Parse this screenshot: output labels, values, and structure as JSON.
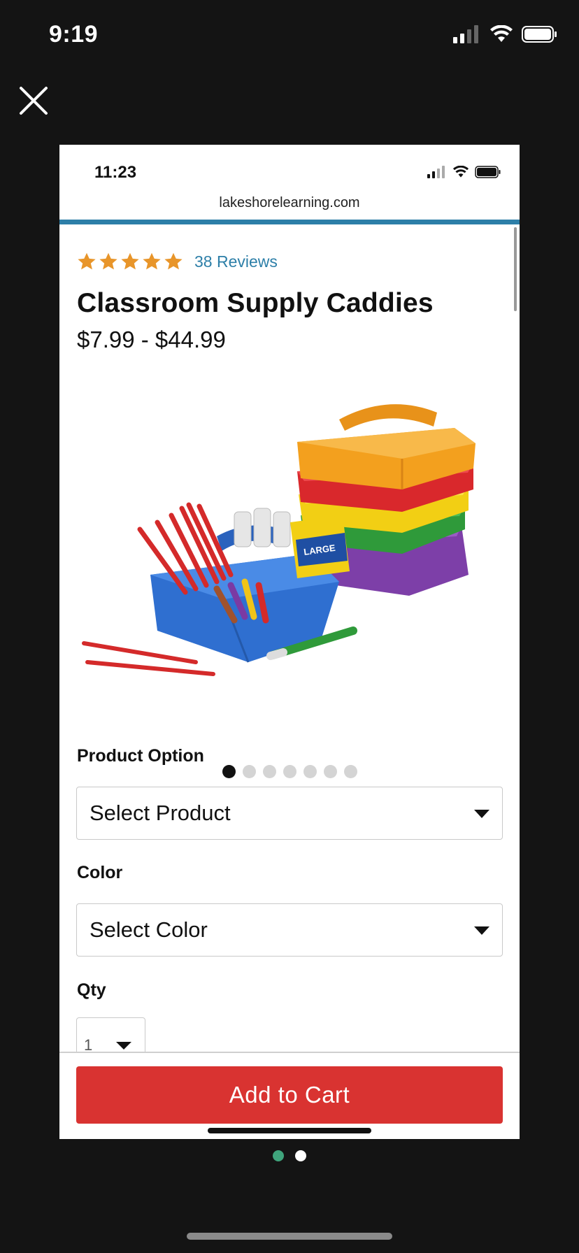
{
  "device": {
    "time": "9:19"
  },
  "screenshot": {
    "status_time": "11:23",
    "url": "lakeshorelearning.com",
    "product": {
      "rating_stars": 5,
      "reviews_label": "38 Reviews",
      "title": "Classroom Supply Caddies",
      "price_range": "$7.99 - $44.99",
      "image_count": 7,
      "active_image": 0
    },
    "form": {
      "product_option_label": "Product Option",
      "product_option_value": "Select Product",
      "color_label": "Color",
      "color_value": "Select Color",
      "qty_label": "Qty",
      "qty_value": "1"
    },
    "add_to_cart_label": "Add to Cart"
  },
  "pager": {
    "count": 2,
    "active": 0
  },
  "colors": {
    "background": "#141414",
    "link_blue": "#2d7fa8",
    "star_orange": "#e8952a",
    "cart_red": "#d93331",
    "pager_green": "#3fa47c"
  }
}
